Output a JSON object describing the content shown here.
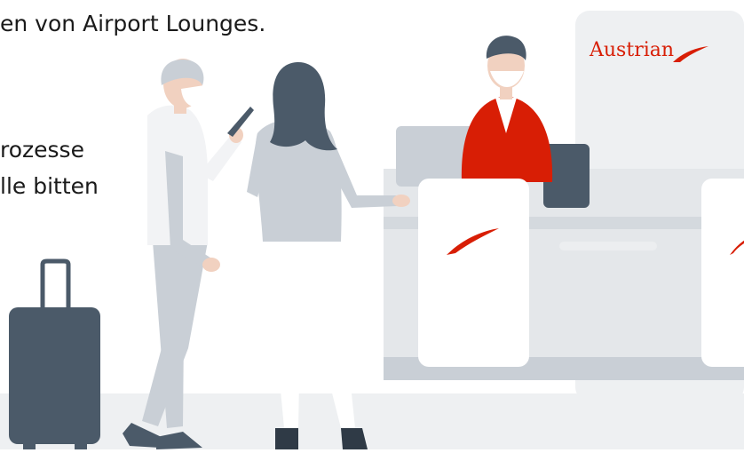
{
  "text": {
    "line1": "en von Airport Lounges.",
    "line2": "rozesse",
    "line3": "lle bitten"
  },
  "brand": {
    "name": "Austrian",
    "logo_icon": "austrian-swoosh-icon",
    "accent_color": "#d81e05"
  },
  "illustration": {
    "scene": "airport-check-in-counter",
    "colors": {
      "slate": "#4b5a69",
      "light_gray": "#c9cfd6",
      "pale_gray": "#eef0f2",
      "counter_gray": "#e4e7ea",
      "skin": "#f1d1c0",
      "white": "#ffffff",
      "red": "#d81e05"
    }
  }
}
